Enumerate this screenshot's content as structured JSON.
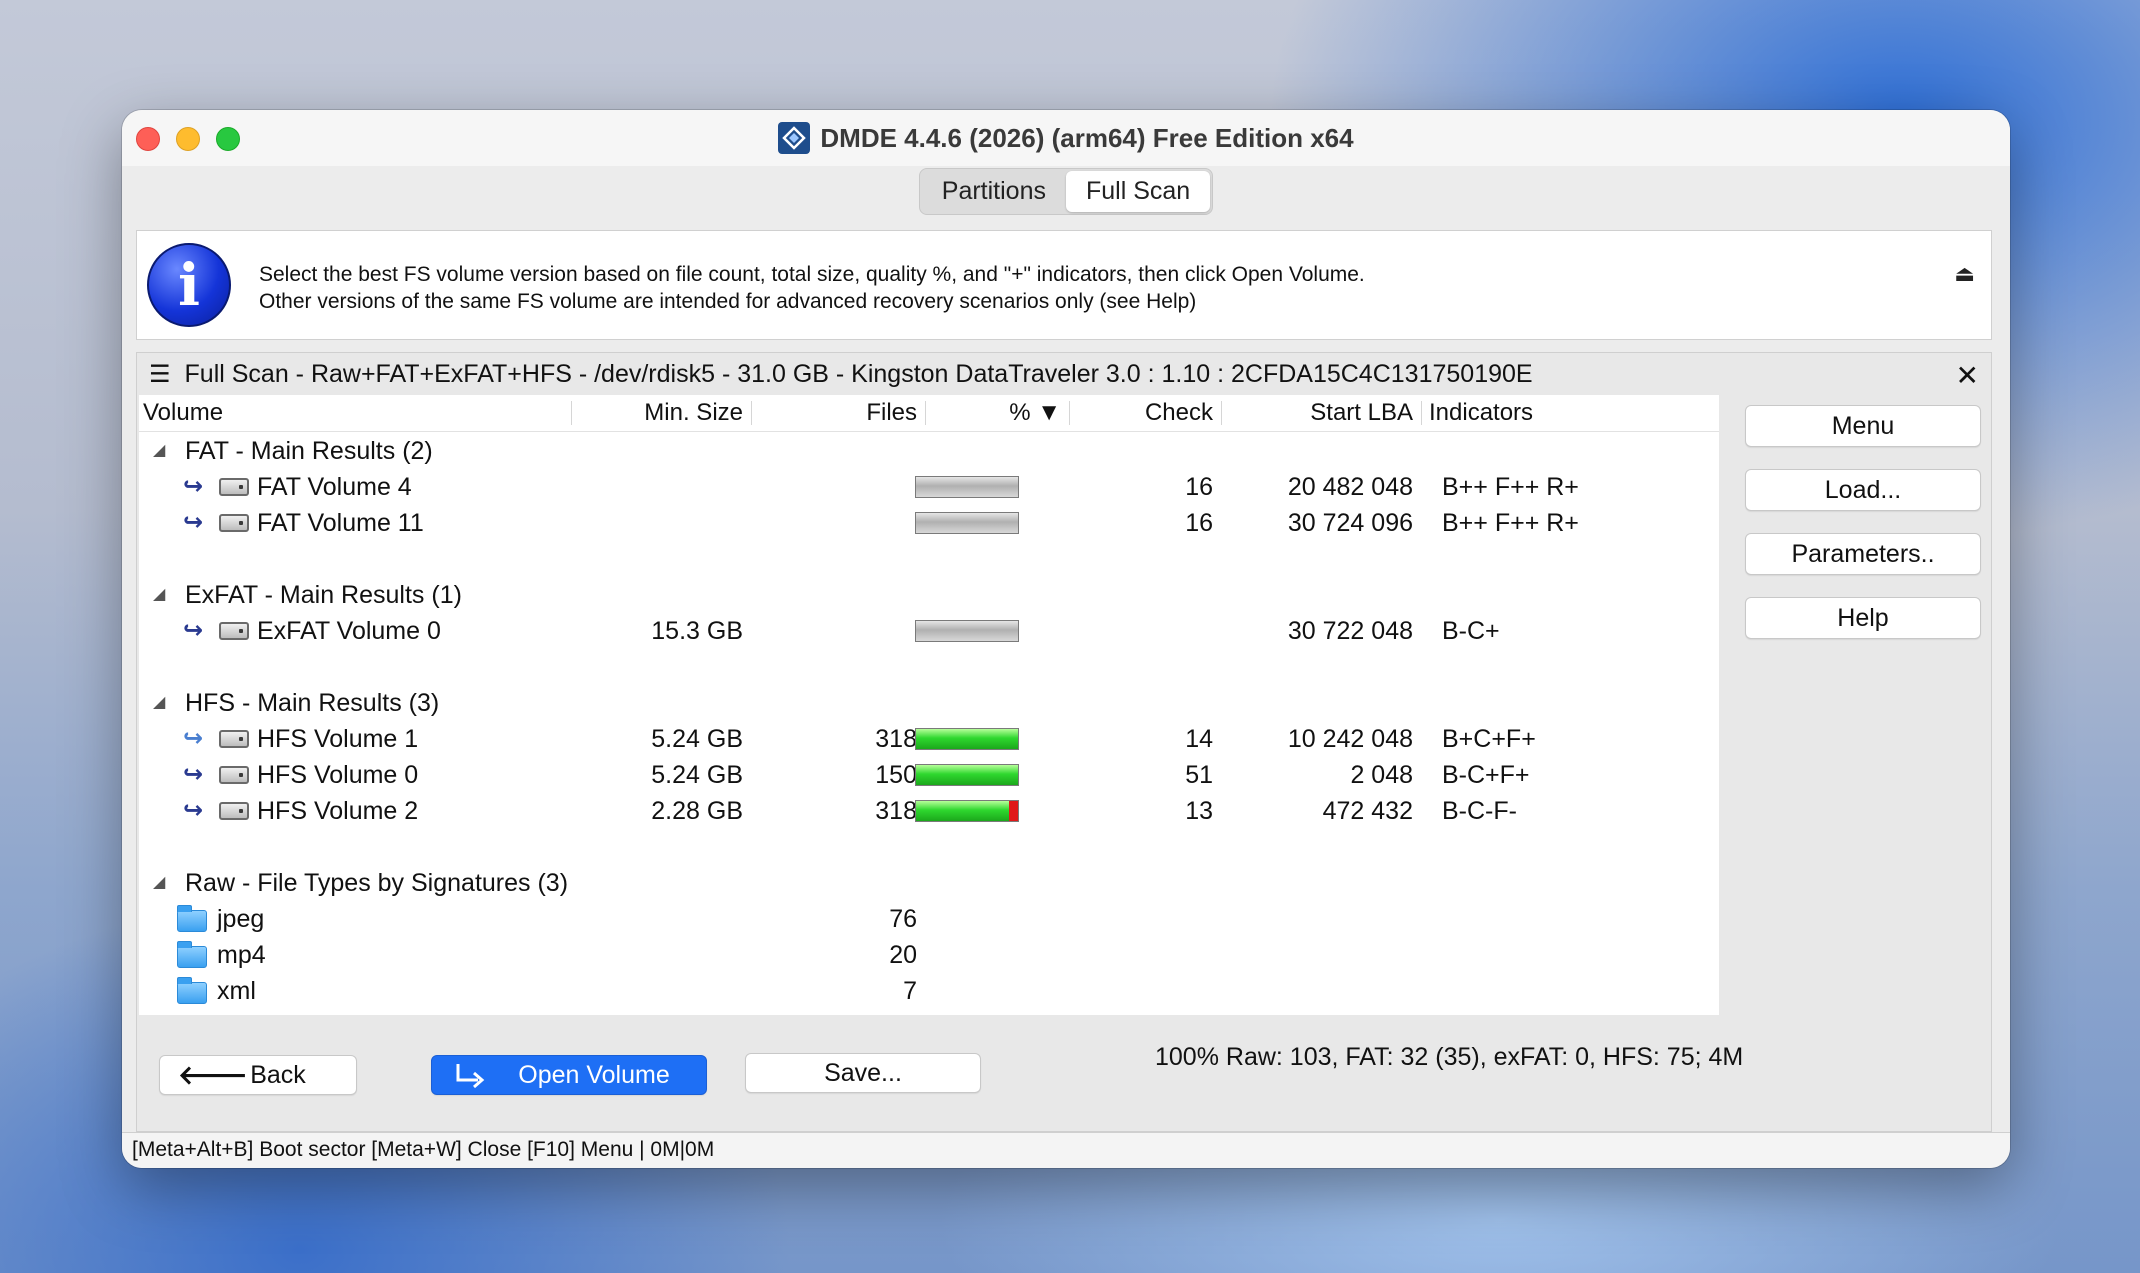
{
  "window": {
    "title": "DMDE 4.4.6 (2026) (arm64) Free Edition x64"
  },
  "tabs": [
    {
      "label": "Partitions",
      "active": false
    },
    {
      "label": "Full Scan",
      "active": true
    }
  ],
  "info": {
    "line1": "Select the best FS volume version based on file count, total size, quality %, and \"+\" indicators, then click Open Volume.",
    "line2": "Other versions of the same FS volume are intended for advanced recovery scenarios only (see Help)",
    "eject_glyph": "⏏"
  },
  "panel": {
    "header": "Full Scan - Raw+FAT+ExFAT+HFS - /dev/rdisk5 - 31.0 GB - Kingston DataTraveler 3.0 : 1.10 : 2CFDA15C4C131750190E",
    "close_glyph": "✕"
  },
  "columns": {
    "volume": "Volume",
    "min_size": "Min. Size",
    "files": "Files",
    "percent": "% ▼",
    "check": "Check",
    "start_lba": "Start LBA",
    "indicators": "Indicators"
  },
  "groups": {
    "fat": {
      "label": "FAT - Main Results (2)"
    },
    "exfat": {
      "label": "ExFAT - Main Results (1)"
    },
    "hfs": {
      "label": "HFS - Main Results (3)"
    },
    "raw": {
      "label": "Raw - File Types by Signatures (3)"
    }
  },
  "volumes": [
    {
      "name": "FAT Volume 4",
      "min_size": "",
      "files": "",
      "quality_pct": null,
      "check": "16",
      "start_lba": "20 482 048",
      "indicators": "B++ F++ R+"
    },
    {
      "name": "FAT Volume 11",
      "min_size": "",
      "files": "",
      "quality_pct": null,
      "check": "16",
      "start_lba": "30 724 096",
      "indicators": "B++ F++ R+"
    },
    {
      "name": "ExFAT Volume 0",
      "min_size": "15.3 GB",
      "files": "",
      "quality_pct": null,
      "check": "",
      "start_lba": "30 722 048",
      "indicators": "B-C+"
    },
    {
      "name": "HFS Volume 1",
      "min_size": "5.24 GB",
      "files": "318",
      "quality_pct": 100,
      "check": "14",
      "start_lba": "10 242 048",
      "indicators": "B+C+F+"
    },
    {
      "name": "HFS Volume 0",
      "min_size": "5.24 GB",
      "files": "150",
      "quality_pct": 100,
      "check": "51",
      "start_lba": "2 048",
      "indicators": "B-C+F+"
    },
    {
      "name": "HFS Volume 2",
      "min_size": "2.28 GB",
      "files": "318",
      "quality_pct": 91,
      "check": "13",
      "start_lba": "472 432",
      "indicators": "B-C-F-"
    }
  ],
  "raw_types": [
    {
      "name": "jpeg",
      "files": "76"
    },
    {
      "name": "mp4",
      "files": "20"
    },
    {
      "name": "xml",
      "files": "7"
    }
  ],
  "side_buttons": {
    "menu": "Menu",
    "load": "Load...",
    "parameters": "Parameters..",
    "help": "Help"
  },
  "bottom": {
    "back": "Back",
    "back_glyph": "🡐",
    "open_volume": "Open Volume",
    "save": "Save...",
    "status": "100% Raw: 103, FAT: 32 (35), exFAT: 0, HFS: 75; 4M"
  },
  "statusbar": {
    "text": "[Meta+Alt+B] Boot sector  [Meta+W] Close  [F10] Menu | 0M|0M"
  },
  "colors": {
    "primary_button": "#1e6ff5",
    "quality_green": "#2fd82f",
    "quality_red": "#e01818"
  }
}
